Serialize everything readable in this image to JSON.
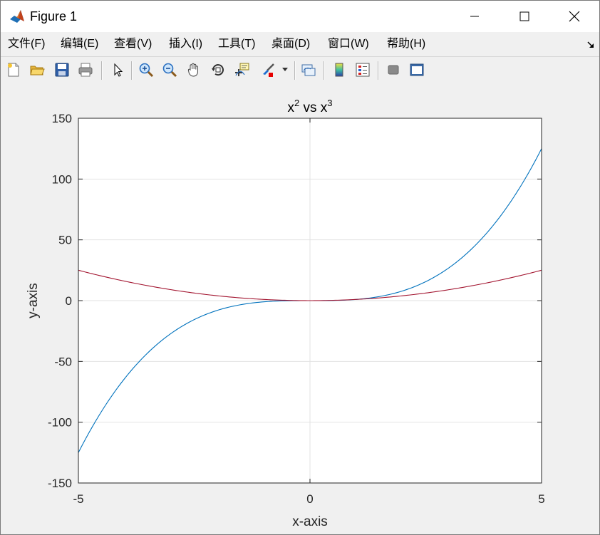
{
  "window": {
    "title": "Figure 1"
  },
  "menu": {
    "items": [
      "文件(F)",
      "编辑(E)",
      "查看(V)",
      "插入(I)",
      "工具(T)",
      "桌面(D)",
      "窗口(W)",
      "帮助(H)"
    ]
  },
  "toolbar": {
    "buttons": [
      "new-figure-icon",
      "open-folder-icon",
      "save-icon",
      "print-icon",
      "pointer-icon",
      "zoom-in-icon",
      "zoom-out-icon",
      "pan-hand-icon",
      "rotate-3d-icon",
      "data-cursor-icon",
      "brush-icon",
      "link-plot-icon",
      "colorbar-icon",
      "legend-icon",
      "hide-plot-tools-icon",
      "show-plot-tools-icon"
    ]
  },
  "colors": {
    "cubic": "#0072bd",
    "square": "#a2142f",
    "grid": "#e2e2e2",
    "axis": "#262626"
  },
  "chart_data": {
    "type": "line",
    "title_base1": "x",
    "title_sup1": "2",
    "title_mid": " vs x",
    "title_sup2": "3",
    "xlabel": "x-axis",
    "ylabel": "y-axis",
    "xlim": [
      -5,
      5
    ],
    "ylim": [
      -150,
      150
    ],
    "xticks": [
      -5,
      0,
      5
    ],
    "xtick_labels": [
      "-5",
      "0",
      "5"
    ],
    "yticks": [
      -150,
      -100,
      -50,
      0,
      50,
      100,
      150
    ],
    "ytick_labels": [
      "-150",
      "-100",
      "-50",
      "0",
      "50",
      "100",
      "150"
    ],
    "grid": true,
    "series": [
      {
        "function": "x^3",
        "exponent": 3,
        "x_range": [
          -5,
          5
        ],
        "color": "#0072bd"
      },
      {
        "function": "x^2",
        "exponent": 2,
        "x_range": [
          -5,
          5
        ],
        "color": "#a2142f"
      }
    ]
  }
}
